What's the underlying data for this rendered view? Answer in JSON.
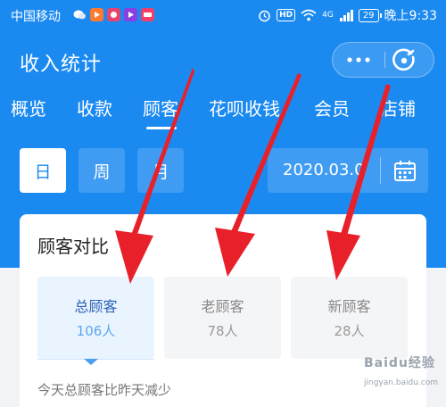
{
  "status_bar": {
    "carrier": "中国移动",
    "hd": "HD",
    "signal": "4G",
    "battery": "29",
    "time": "晚上9:33"
  },
  "header": {
    "title": "收入统计"
  },
  "tabs": [
    {
      "label": "概览"
    },
    {
      "label": "收款"
    },
    {
      "label": "顾客",
      "active": true
    },
    {
      "label": "花呗收钱"
    },
    {
      "label": "会员"
    },
    {
      "label": "店铺"
    }
  ],
  "date_filter": {
    "day": "日",
    "week": "周",
    "month": "月",
    "date": "2020.03.0"
  },
  "customer_compare": {
    "title": "顾客对比",
    "info": "i",
    "stats": [
      {
        "label": "总顾客",
        "value": "106人",
        "active": true
      },
      {
        "label": "老顾客",
        "value": "78人"
      },
      {
        "label": "新顾客",
        "value": "28人"
      }
    ],
    "summary": "今天总顾客比昨天减少"
  },
  "watermark": {
    "title": "Baidu经验",
    "sub": "jingyan.baidu.com"
  },
  "colors": {
    "primary": "#1b8af0",
    "arrow": "#e8202a",
    "active_tile": "#eaf4fe"
  }
}
